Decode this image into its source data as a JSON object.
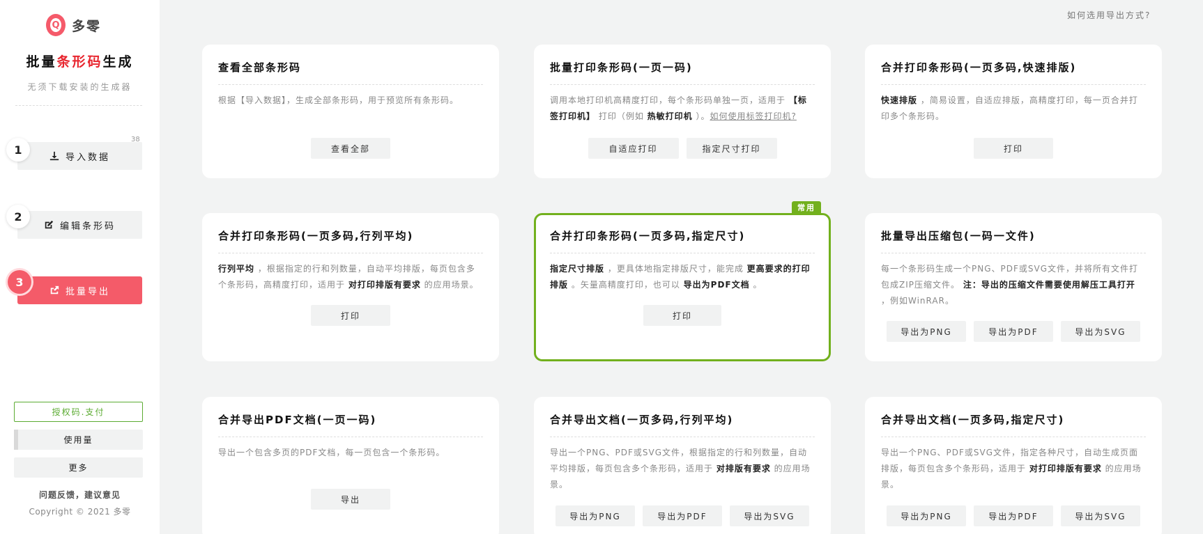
{
  "sidebar": {
    "logo_glyph": "Q",
    "logo_text": "多零",
    "title_prefix": "批量",
    "title_highlight": "条形码",
    "title_suffix": "生成",
    "subtitle": "无须下载安装的生成器",
    "steps": [
      {
        "num": "1",
        "label": "导入数据",
        "icon": "download-icon"
      },
      {
        "num": "2",
        "label": "编辑条形码",
        "icon": "edit-icon"
      },
      {
        "num": "3",
        "label": "批量导出",
        "icon": "export-icon",
        "active": true
      }
    ],
    "record_count": "38",
    "license_label": "授权码.支付",
    "usage_label": "使用量",
    "more_label": "更多",
    "feedback_label": "问题反馈，建议意见",
    "copyright": "Copyright © 2021 多零"
  },
  "header": {
    "help_link": "如何选用导出方式?"
  },
  "cards": [
    {
      "title": "查看全部条形码",
      "desc": [
        "根据【导入数据】，生成全部条形码，用于预览所有条形码。"
      ],
      "buttons": [
        "查看全部"
      ]
    },
    {
      "title": "批量打印条形码(一页一码)",
      "desc": [
        "调用本地打印机高精度打印，每个条形码单独一页，适用于 ",
        "【标签打印机】",
        " 打印（例如 ",
        "热敏打印机",
        " ）。",
        "如何使用标签打印机?"
      ],
      "buttons": [
        "自适应打印",
        "指定尺寸打印"
      ]
    },
    {
      "title": "合并打印条形码(一页多码,快速排版)",
      "desc": [
        "快速排版",
        " ，简易设置，自适应排版，高精度打印，每一页合并打印多个条形码。"
      ],
      "buttons": [
        "打印"
      ]
    },
    {
      "title": "合并打印条形码(一页多码,行列平均)",
      "desc": [
        "行列平均",
        " ，根据指定的行和列数量，自动平均排版，每页包含多个条形码，高精度打印，适用于 ",
        "对打印排版有要求",
        " 的应用场景。"
      ],
      "buttons": [
        "打印"
      ]
    },
    {
      "badge": "常用",
      "title": "合并打印条形码(一页多码,指定尺寸)",
      "desc": [
        "指定尺寸排版",
        " ，更具体地指定排版尺寸，能完成 ",
        "更高要求的打印排版",
        " 。矢量高精度打印，也可以 ",
        "导出为PDF文档",
        " 。"
      ],
      "buttons": [
        "打印"
      ]
    },
    {
      "title": "批量导出压缩包(一码一文件)",
      "desc": [
        "每一个条形码生成一个PNG、PDF或SVG文件，并将所有文件打包成ZIP压缩文件。 ",
        "注：导出的压缩文件需要使用解压工具打开",
        " ，例如WinRAR。"
      ],
      "buttons": [
        "导出为PNG",
        "导出为PDF",
        "导出为SVG"
      ]
    },
    {
      "title": "合并导出PDF文档(一页一码)",
      "desc": [
        "导出一个包含多页的PDF文档，每一页包含一个条形码。"
      ],
      "buttons": [
        "导出"
      ]
    },
    {
      "title": "合并导出文档(一页多码,行列平均)",
      "desc": [
        "导出一个PNG、PDF或SVG文件，根据指定的行和列数量，自动平均排版，每页包含多个条形码，适用于 ",
        "对排版有要求",
        " 的应用场景。"
      ],
      "buttons": [
        "导出为PNG",
        "导出为PDF",
        "导出为SVG"
      ]
    },
    {
      "title": "合并导出文档(一页多码,指定尺寸)",
      "desc": [
        "导出一个PNG、PDF或SVG文件，指定各种尺寸，自动生成页面排版，每页包含多个条形码，适用于 ",
        "对打印排版有要求",
        " 的应用场景。"
      ],
      "buttons": [
        "导出为PNG",
        "导出为PDF",
        "导出为SVG"
      ]
    }
  ],
  "colors": {
    "accent": "#f45b69",
    "featured": "#72b01d",
    "license": "#5bab31"
  }
}
